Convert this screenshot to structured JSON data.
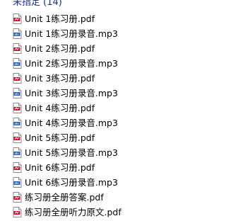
{
  "group": {
    "header": "未指定 (14)"
  },
  "files": [
    {
      "name": "Unit 1练习册.pdf",
      "icon": "pdf-file-icon"
    },
    {
      "name": "Unit 1练习册录音.mp3",
      "icon": "mp3-file-icon"
    },
    {
      "name": "Unit 2练习册.pdf",
      "icon": "pdf-file-icon"
    },
    {
      "name": "Unit 2练习册录音.mp3",
      "icon": "mp3-file-icon"
    },
    {
      "name": "Unit 3练习册.pdf",
      "icon": "pdf-file-icon"
    },
    {
      "name": "Unit 3练习册录音.mp3",
      "icon": "mp3-file-icon"
    },
    {
      "name": "Unit 4练习册.pdf",
      "icon": "pdf-file-icon"
    },
    {
      "name": "Unit 4练习册录音.mp3",
      "icon": "mp3-file-icon"
    },
    {
      "name": "Unit 5练习册.pdf",
      "icon": "pdf-file-icon"
    },
    {
      "name": "Unit 5练习册录音.mp3",
      "icon": "mp3-file-icon"
    },
    {
      "name": "Unit 6练习册.pdf",
      "icon": "pdf-file-icon"
    },
    {
      "name": "Unit 6练习册录音.mp3",
      "icon": "mp3-file-icon"
    },
    {
      "name": "练习册全册答案.pdf",
      "icon": "pdf-file-icon"
    },
    {
      "name": "练习册全册听力原文.pdf",
      "icon": "pdf-file-icon"
    }
  ],
  "colors": {
    "header": "#1e3287",
    "pdf_accent": "#c8102e",
    "mp3_accent": "#1f5fbf"
  }
}
